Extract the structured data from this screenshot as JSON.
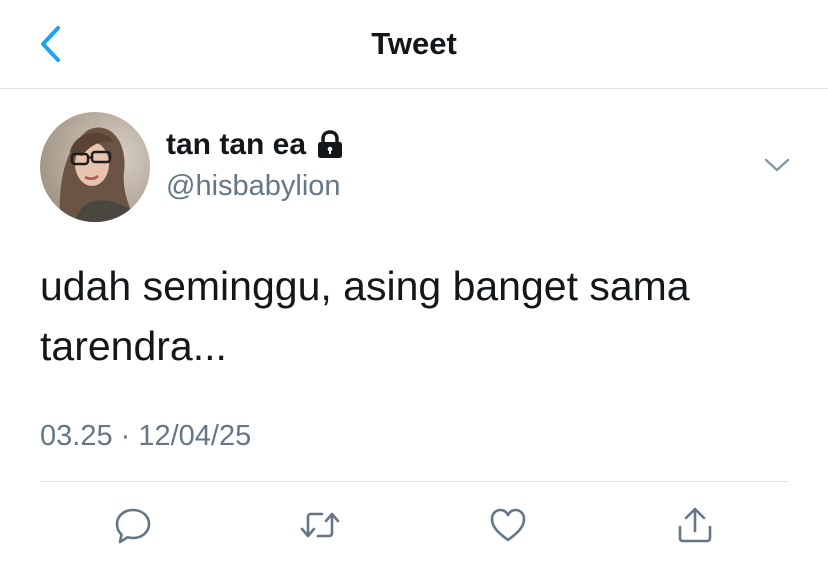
{
  "header": {
    "title": "Tweet",
    "back_icon": "chevron-left-icon"
  },
  "colors": {
    "accent": "#1da1f2",
    "text_primary": "#14171a",
    "text_secondary": "#657786",
    "divider": "#dfe3e7"
  },
  "author": {
    "name": "tan tan ea",
    "handle": "@hisbabylion",
    "protected_icon": "lock-icon",
    "menu_icon": "chevron-down-icon"
  },
  "tweet": {
    "text": "udah seminggu, asing banget sama\ntarendra...",
    "timestamp": "03.25 · 12/04/25"
  },
  "actions": [
    {
      "name": "reply",
      "icon": "reply-icon"
    },
    {
      "name": "retweet",
      "icon": "retweet-icon"
    },
    {
      "name": "like",
      "icon": "heart-icon"
    },
    {
      "name": "share",
      "icon": "share-icon"
    }
  ]
}
